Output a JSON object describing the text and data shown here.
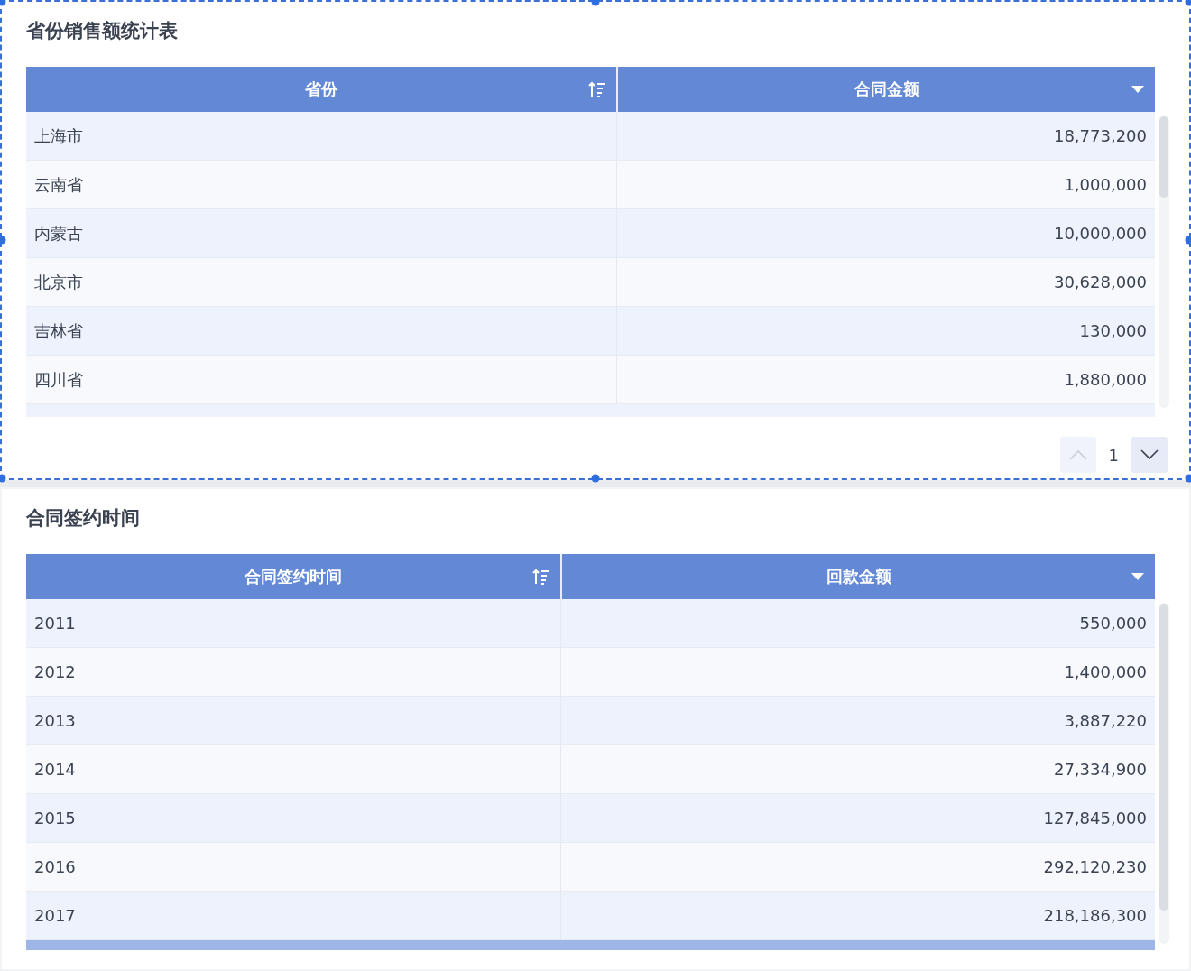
{
  "widgets": [
    {
      "title": "省份销售额统计表",
      "selected": true,
      "columns": [
        {
          "label": "省份",
          "kind": "sort"
        },
        {
          "label": "合同金额",
          "kind": "dropdown"
        }
      ],
      "rows": [
        [
          "上海市",
          "18,773,200"
        ],
        [
          "云南省",
          "1,000,000"
        ],
        [
          "内蒙古",
          "10,000,000"
        ],
        [
          "北京市",
          "30,628,000"
        ],
        [
          "吉林省",
          "130,000"
        ],
        [
          "四川省",
          "1,880,000"
        ]
      ],
      "pagination": {
        "page": "1",
        "prev_disabled": true,
        "next_disabled": false
      }
    },
    {
      "title": "合同签约时间",
      "selected": false,
      "columns": [
        {
          "label": "合同签约时间",
          "kind": "sort"
        },
        {
          "label": "回款金额",
          "kind": "dropdown"
        }
      ],
      "rows": [
        [
          "2011",
          "550,000"
        ],
        [
          "2012",
          "1,400,000"
        ],
        [
          "2013",
          "3,887,220"
        ],
        [
          "2014",
          "27,334,900"
        ],
        [
          "2015",
          "127,845,000"
        ],
        [
          "2016",
          "292,120,230"
        ],
        [
          "2017",
          "218,186,300"
        ]
      ]
    }
  ]
}
